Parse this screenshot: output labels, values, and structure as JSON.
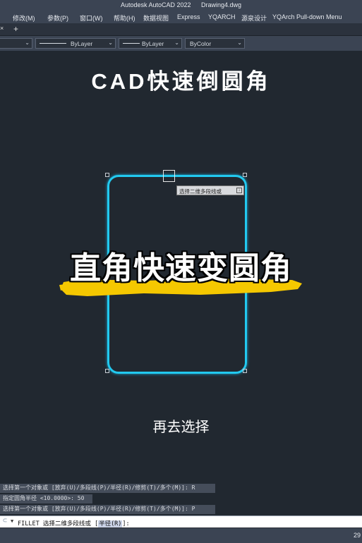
{
  "titlebar": {
    "app": "Autodesk AutoCAD 2022",
    "file": "Drawing4.dwg"
  },
  "menu": [
    "修改(M)",
    "参数(P)",
    "窗口(W)",
    "帮助(H)",
    "数据视图",
    "Express",
    "YQARCH",
    "源泉设计",
    "YQArch Pull-down Menu"
  ],
  "tabs": {
    "close": "×",
    "add": "+"
  },
  "properties": {
    "linetype": "ByLayer",
    "lineweight": "ByLayer",
    "color": "ByColor"
  },
  "canvas": {
    "heading": "CAD快速倒圆角",
    "tooltip": "选择二维多段线或",
    "overlay": "直角快速变圆角",
    "subtitle": "再去选择"
  },
  "history": [
    "选择第一个对象或 [放弃(U)/多段线(P)/半径(R)/修剪(T)/多个(M)]: R",
    "指定圆角半径 <10.0000>: 50",
    "选择第一个对象或 [放弃(U)/多段线(P)/半径(R)/修剪(T)/多个(M)]: P"
  ],
  "command": {
    "prompt": "FILLET 选择二维多段线或 [",
    "option": "半径(R)",
    "suffix": "]:"
  },
  "status": {
    "coord": "29"
  },
  "colors": {
    "shape": "#22c9ef",
    "highlight": "#f5c800",
    "canvas": "#212830"
  }
}
